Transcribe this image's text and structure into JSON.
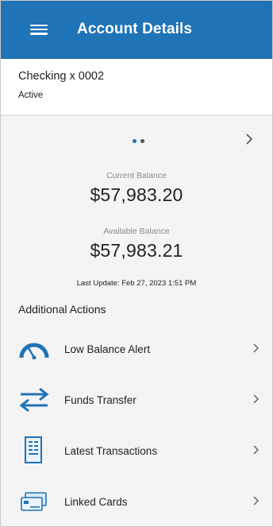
{
  "header": {
    "title": "Account Details",
    "menu_icon": "hamburger-menu-icon"
  },
  "account": {
    "name": "Checking x 0002",
    "status": "Active"
  },
  "carousel": {
    "pages": 2,
    "active_page": 1,
    "next_icon": "chevron-right-icon"
  },
  "balances": {
    "current_label": "Current Balance",
    "current_value": "$57,983.20",
    "available_label": "Available Balance",
    "available_value": "$57,983.21",
    "last_update": "Last Update: Feb 27, 2023 1:51 PM"
  },
  "additional_actions": {
    "title": "Additional Actions",
    "items": [
      {
        "label": "Low Balance Alert",
        "icon": "gauge-icon"
      },
      {
        "label": "Funds Transfer",
        "icon": "transfer-arrows-icon"
      },
      {
        "label": "Latest Transactions",
        "icon": "receipt-icon"
      },
      {
        "label": "Linked Cards",
        "icon": "cards-icon"
      }
    ]
  },
  "colors": {
    "header_bg": "#1f73b7",
    "accent": "#1f73b7",
    "content_bg": "#f4f4f4"
  }
}
